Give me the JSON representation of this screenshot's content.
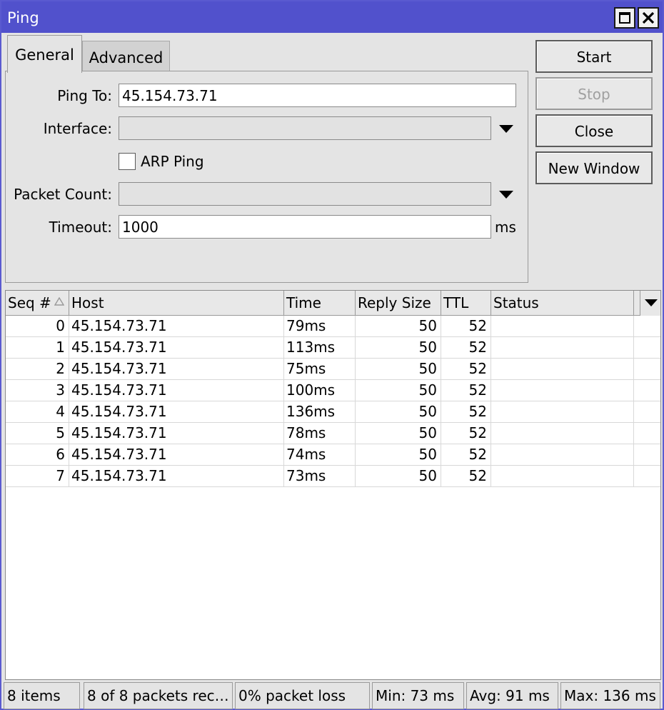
{
  "window": {
    "title": "Ping"
  },
  "tabs": [
    {
      "label": "General",
      "active": true
    },
    {
      "label": "Advanced",
      "active": false
    }
  ],
  "form": {
    "ping_to": {
      "label": "Ping To:",
      "value": "45.154.73.71"
    },
    "interface": {
      "label": "Interface:",
      "value": ""
    },
    "arp_ping": {
      "label": "ARP Ping",
      "checked": false
    },
    "packet_count": {
      "label": "Packet Count:",
      "value": ""
    },
    "timeout": {
      "label": "Timeout:",
      "value": "1000",
      "unit": "ms"
    }
  },
  "buttons": {
    "start": "Start",
    "stop": "Stop",
    "close": "Close",
    "new_window": "New Window"
  },
  "table": {
    "columns": [
      "Seq #",
      "Host",
      "Time",
      "Reply Size",
      "TTL",
      "Status"
    ],
    "rows": [
      {
        "seq": "0",
        "host": "45.154.73.71",
        "time": "79ms",
        "size": "50",
        "ttl": "52",
        "status": ""
      },
      {
        "seq": "1",
        "host": "45.154.73.71",
        "time": "113ms",
        "size": "50",
        "ttl": "52",
        "status": ""
      },
      {
        "seq": "2",
        "host": "45.154.73.71",
        "time": "75ms",
        "size": "50",
        "ttl": "52",
        "status": ""
      },
      {
        "seq": "3",
        "host": "45.154.73.71",
        "time": "100ms",
        "size": "50",
        "ttl": "52",
        "status": ""
      },
      {
        "seq": "4",
        "host": "45.154.73.71",
        "time": "136ms",
        "size": "50",
        "ttl": "52",
        "status": ""
      },
      {
        "seq": "5",
        "host": "45.154.73.71",
        "time": "78ms",
        "size": "50",
        "ttl": "52",
        "status": ""
      },
      {
        "seq": "6",
        "host": "45.154.73.71",
        "time": "74ms",
        "size": "50",
        "ttl": "52",
        "status": ""
      },
      {
        "seq": "7",
        "host": "45.154.73.71",
        "time": "73ms",
        "size": "50",
        "ttl": "52",
        "status": ""
      }
    ]
  },
  "status_bar": {
    "items": "8 items",
    "received": "8 of 8 packets rec…",
    "loss": "0% packet loss",
    "min": "Min: 73 ms",
    "avg": "Avg: 91 ms",
    "max": "Max: 136 ms"
  },
  "colors": {
    "titlebar": "#5151cc",
    "window_bg": "#e4e4e4",
    "disabled_text": "#a0a0a0"
  },
  "icons": {
    "maximize": "maximize-icon",
    "close": "close-icon",
    "dropdown": "dropdown-arrow-icon",
    "sort": "sort-ascending-icon",
    "column_menu": "column-menu-icon"
  }
}
